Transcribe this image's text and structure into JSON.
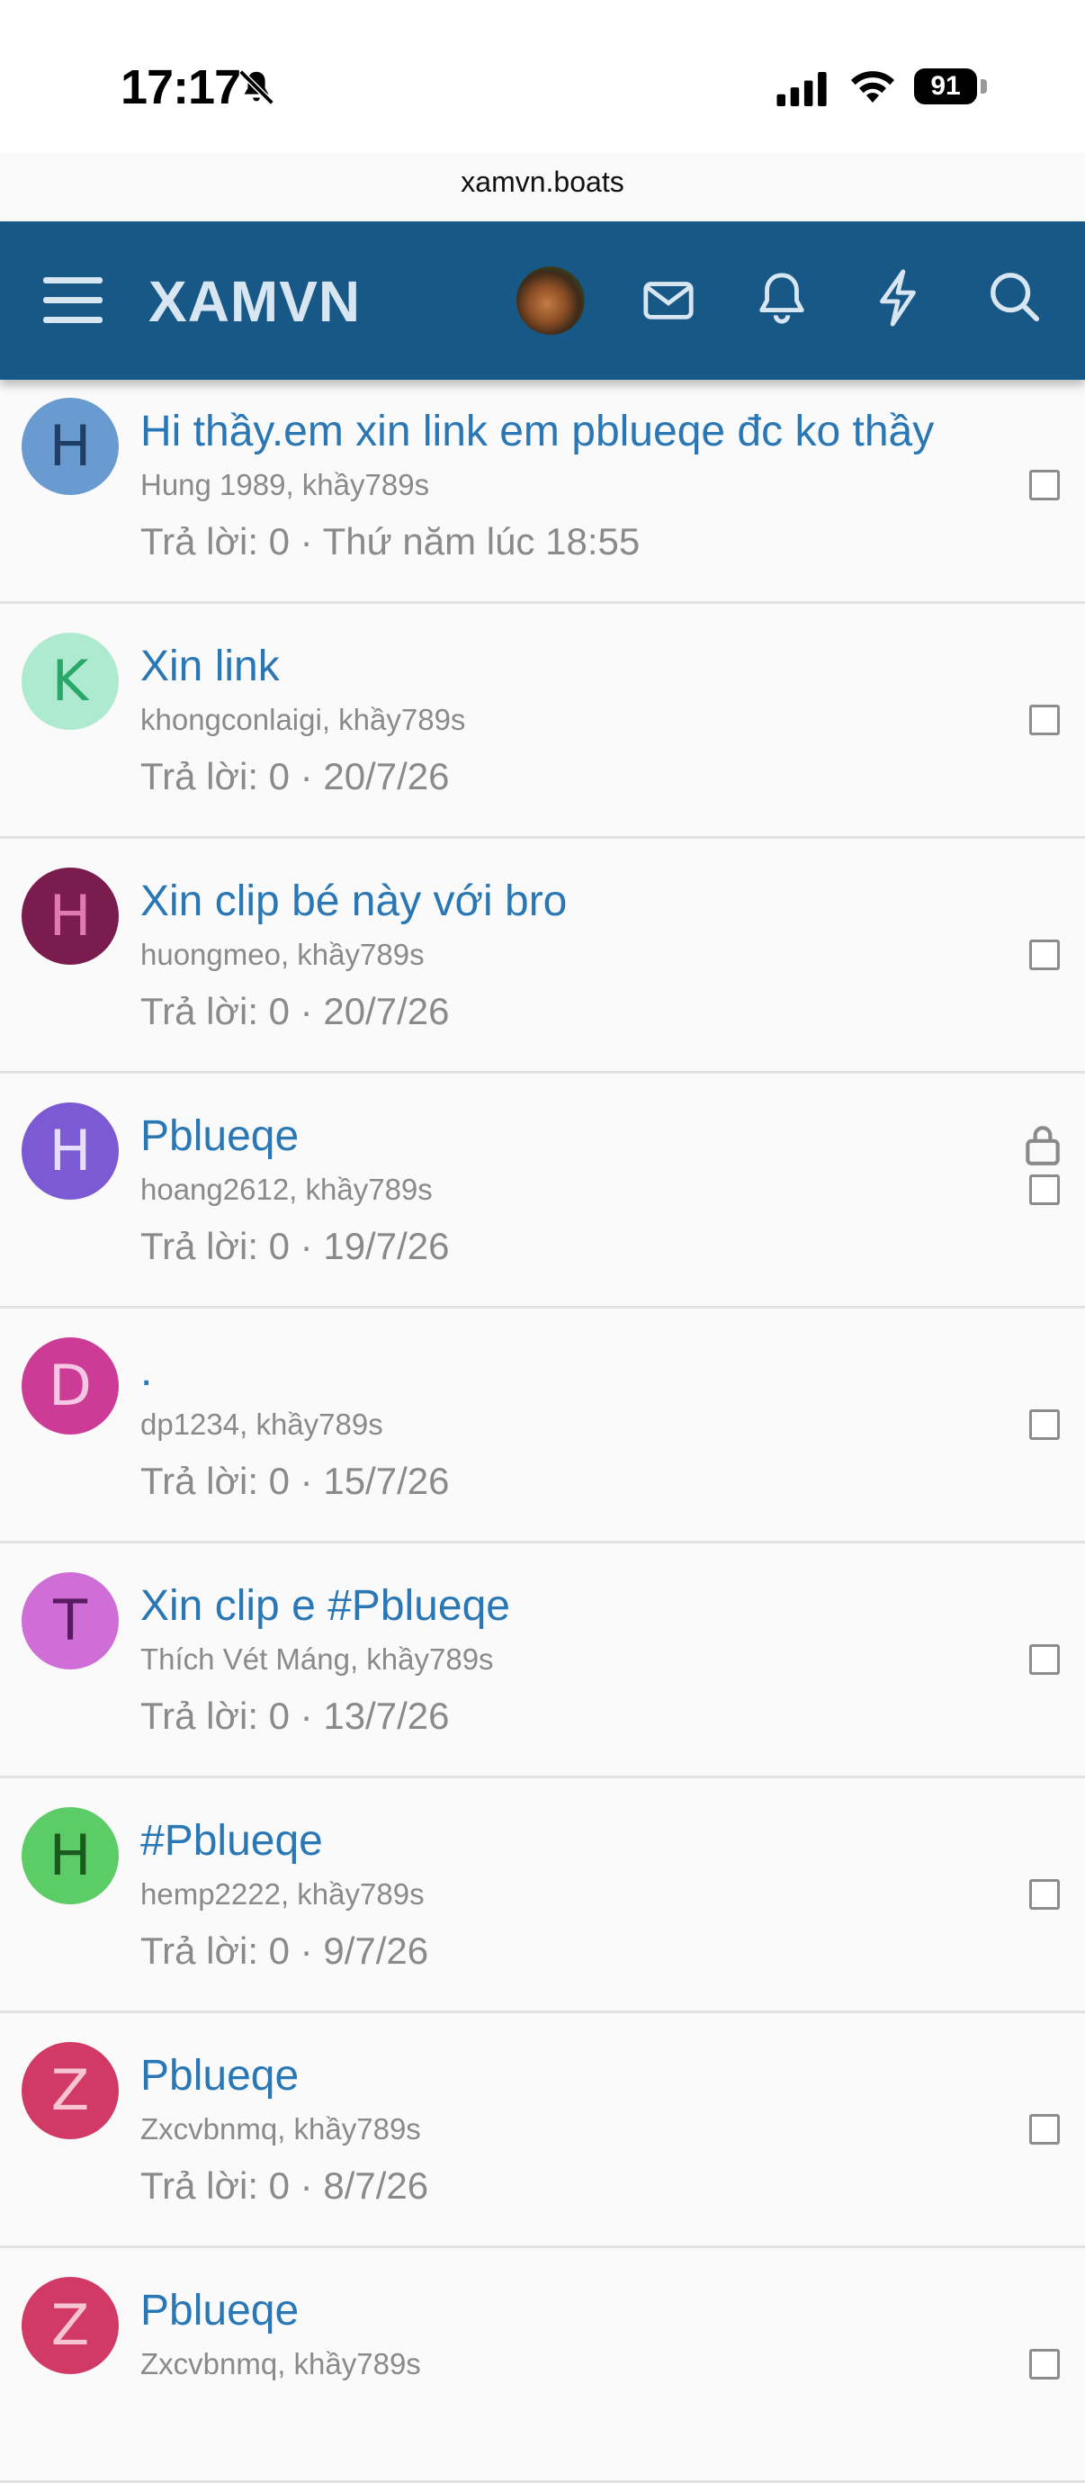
{
  "status_bar": {
    "time": "17:17",
    "battery": "91"
  },
  "browser": {
    "url": "xamvn.boats"
  },
  "header": {
    "brand": "XAMVN"
  },
  "threads": [
    {
      "avatar_letter": "H",
      "avatar_bg": "#6a9bd0",
      "avatar_fg": "#1f3f66",
      "title": "Hi thầy.em xin link em pblueqe đc ko thầy",
      "meta": "Hung 1989, khầy789s",
      "stats": "Trả lời: 0 · Thứ năm lúc 18:55",
      "locked": false
    },
    {
      "avatar_letter": "K",
      "avatar_bg": "#aeead0",
      "avatar_fg": "#2aa86a",
      "title": "Xin link",
      "meta": "khongconlaigi, khầy789s",
      "stats": "Trả lời: 0 · 20/7/26",
      "locked": false
    },
    {
      "avatar_letter": "H",
      "avatar_bg": "#7a1c4e",
      "avatar_fg": "#e07ab0",
      "title": "Xin clip bé này với bro",
      "meta": "huongmeo, khầy789s",
      "stats": "Trả lời: 0 · 20/7/26",
      "locked": false
    },
    {
      "avatar_letter": "H",
      "avatar_bg": "#7b5ad3",
      "avatar_fg": "#e6defa",
      "title": "Pblueqe",
      "meta": "hoang2612, khầy789s",
      "stats": "Trả lời: 0 · 19/7/26",
      "locked": true
    },
    {
      "avatar_letter": "D",
      "avatar_bg": "#cc3c96",
      "avatar_fg": "#f4c8e2",
      "title": ".",
      "meta": "dp1234, khầy789s",
      "stats": "Trả lời: 0 · 15/7/26",
      "locked": false
    },
    {
      "avatar_letter": "T",
      "avatar_bg": "#cf6ed6",
      "avatar_fg": "#5a1c60",
      "title": "Xin clip e #Pblueqe",
      "meta": "Thích Vét Máng, khầy789s",
      "stats": "Trả lời: 0 · 13/7/26",
      "locked": false
    },
    {
      "avatar_letter": "H",
      "avatar_bg": "#5ccc66",
      "avatar_fg": "#1a5a1e",
      "title": "#Pblueqe",
      "meta": "hemp2222, khầy789s",
      "stats": "Trả lời: 0 · 9/7/26",
      "locked": false
    },
    {
      "avatar_letter": "Z",
      "avatar_bg": "#d23a66",
      "avatar_fg": "#f6c4d2",
      "title": "Pblueqe",
      "meta": "Zxcvbnmq, khầy789s",
      "stats": "Trả lời: 0 · 8/7/26",
      "locked": false
    },
    {
      "avatar_letter": "Z",
      "avatar_bg": "#d23a66",
      "avatar_fg": "#f6c4d2",
      "title": "Pblueqe",
      "meta": "Zxcvbnmq, khầy789s",
      "stats": "",
      "locked": false
    }
  ]
}
